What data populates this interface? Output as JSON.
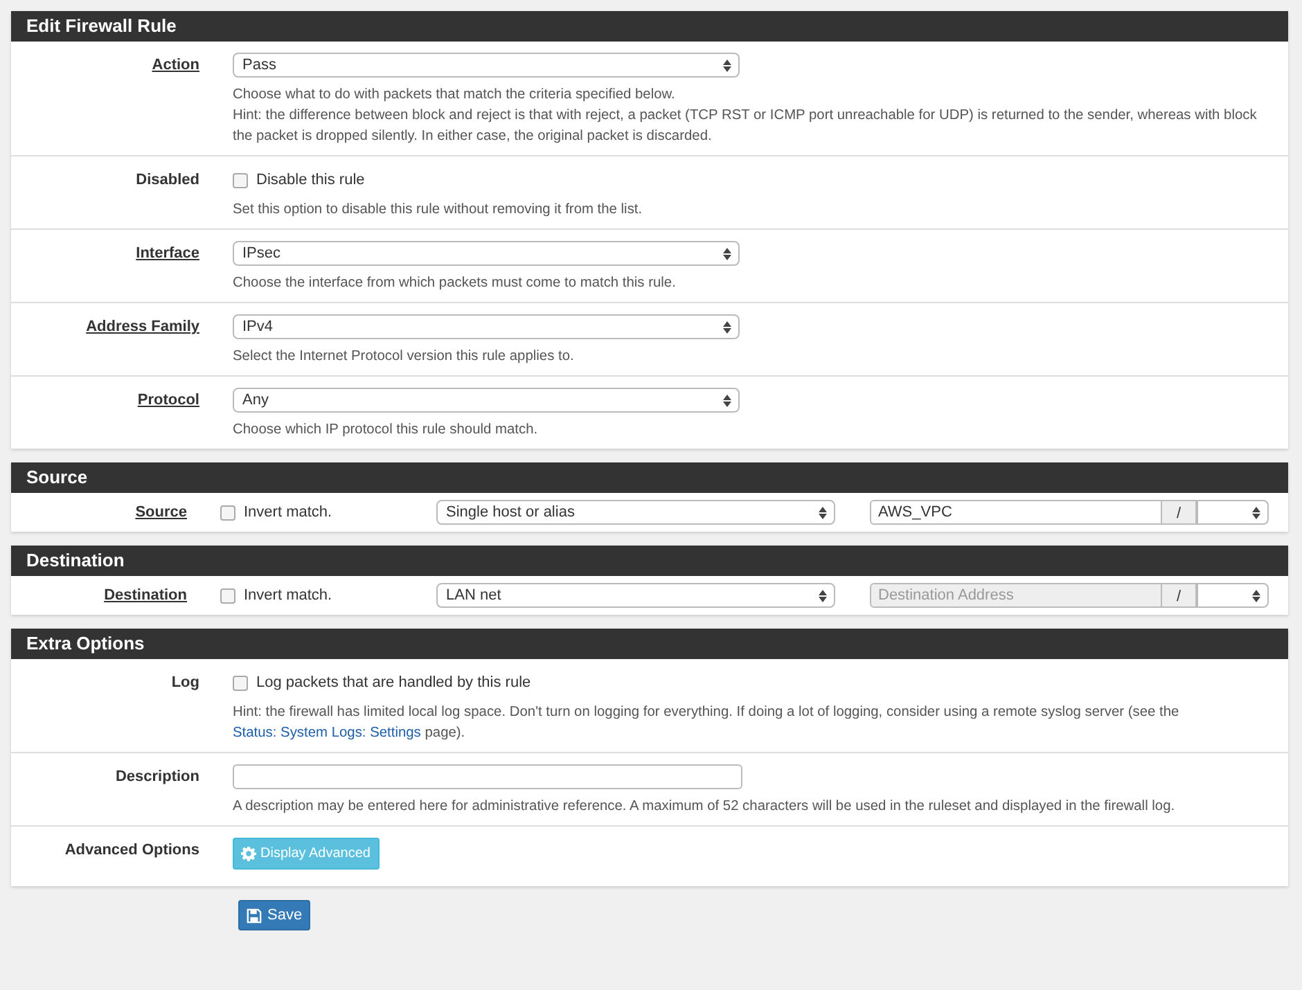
{
  "sections": [
    {
      "title": "Edit Firewall Rule",
      "rows": [
        {
          "kind": "select",
          "label": "Action",
          "linked": true,
          "value": "Pass",
          "hint": [
            {
              "kind": "text",
              "text": "Choose what to do with packets that match the criteria specified below."
            },
            {
              "kind": "break"
            },
            {
              "kind": "text",
              "text": "Hint: the difference between block and reject is that with reject, a packet (TCP RST or ICMP port unreachable for UDP) is returned to the sender, whereas with block the packet is dropped silently. In either case, the original packet is discarded."
            }
          ]
        },
        {
          "kind": "checkbox",
          "label": "Disabled",
          "linked": false,
          "checked": false,
          "text": "Disable this rule",
          "hint": [
            {
              "kind": "text",
              "text": "Set this option to disable this rule without removing it from the list."
            }
          ]
        },
        {
          "kind": "select",
          "label": "Interface",
          "linked": true,
          "value": "IPsec",
          "hint": [
            {
              "kind": "text",
              "text": "Choose the interface from which packets must come to match this rule."
            }
          ]
        },
        {
          "kind": "select",
          "label": "Address Family",
          "linked": true,
          "value": "IPv4",
          "hint": [
            {
              "kind": "text",
              "text": "Select the Internet Protocol version this rule applies to."
            }
          ]
        },
        {
          "kind": "select",
          "label": "Protocol",
          "linked": true,
          "value": "Any",
          "hint": [
            {
              "kind": "text",
              "text": "Choose which IP protocol this rule should match."
            }
          ]
        }
      ]
    },
    {
      "title": "Source",
      "rows": [
        {
          "kind": "address",
          "label": "Source",
          "linked": true,
          "checked": false,
          "text": "Invert match.",
          "type": "Single host or alias",
          "address": {
            "value": "AWS_VPC",
            "disabled": false
          },
          "slash": "/"
        }
      ]
    },
    {
      "title": "Destination",
      "rows": [
        {
          "kind": "address",
          "label": "Destination",
          "linked": true,
          "checked": false,
          "text": "Invert match.",
          "type": "LAN net",
          "address": {
            "placeholder": "Destination Address",
            "disabled": true
          },
          "slash": "/"
        }
      ]
    },
    {
      "title": "Extra Options",
      "rows": [
        {
          "kind": "checkbox",
          "label": "Log",
          "linked": false,
          "checked": false,
          "text": "Log packets that are handled by this rule",
          "hint": [
            {
              "kind": "text",
              "text": "Hint: the firewall has limited local log space. Don't turn on logging for everything. If doing a lot of logging, consider using a remote syslog server (see the "
            },
            {
              "kind": "link",
              "text": "Status: System Logs: Settings"
            },
            {
              "kind": "text",
              "text": " page)."
            }
          ]
        },
        {
          "kind": "text",
          "label": "Description",
          "linked": false,
          "value": "",
          "hint": [
            {
              "kind": "text",
              "text": "A description may be entered here for administrative reference. A maximum of 52 characters will be used in the ruleset and displayed in the firewall log."
            }
          ]
        },
        {
          "kind": "button",
          "label": "Advanced Options",
          "linked": false,
          "button": "Display Advanced"
        }
      ]
    }
  ],
  "save": "Save"
}
